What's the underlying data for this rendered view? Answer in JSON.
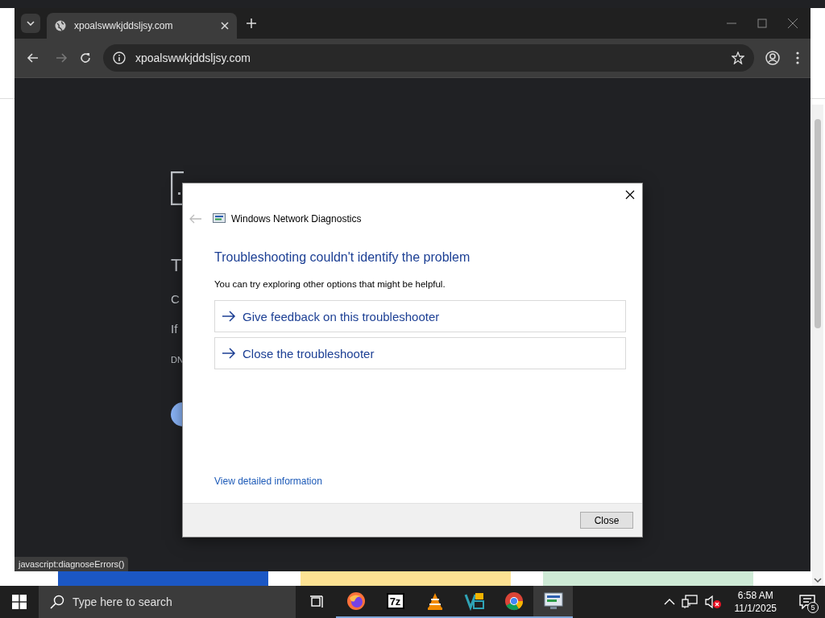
{
  "browser": {
    "tab": {
      "title": "xpoalswwkjddsljsy.com"
    },
    "address": "xpoalswwkjddsljsy.com",
    "page_fragments": [
      {
        "kind": "title",
        "text": "T"
      },
      {
        "kind": "body",
        "text": "C"
      },
      {
        "kind": "body",
        "text": "If"
      },
      {
        "kind": "code",
        "text": "DN"
      }
    ],
    "status_url": "javascript:diagnoseErrors()"
  },
  "dialog": {
    "title": "Windows Network Diagnostics",
    "heading": "Troubleshooting couldn't identify the problem",
    "message": "You can try exploring other options that might be helpful.",
    "options": [
      "Give feedback on this troubleshooter",
      "Close the troubleshooter"
    ],
    "link": "View detailed information",
    "button": "Close"
  },
  "taskbar": {
    "search_placeholder": "Type here to search",
    "apps": [
      {
        "kind": "firefox",
        "selected": false
      },
      {
        "kind": "archiver",
        "label": "7z",
        "selected": false
      },
      {
        "kind": "cone",
        "selected": false
      },
      {
        "kind": "shapes",
        "selected": false
      },
      {
        "kind": "chrome",
        "selected": false
      },
      {
        "kind": "diagnostics",
        "selected": true
      }
    ],
    "time": "6:58 AM",
    "date": "11/1/2025",
    "notifications": "5"
  }
}
